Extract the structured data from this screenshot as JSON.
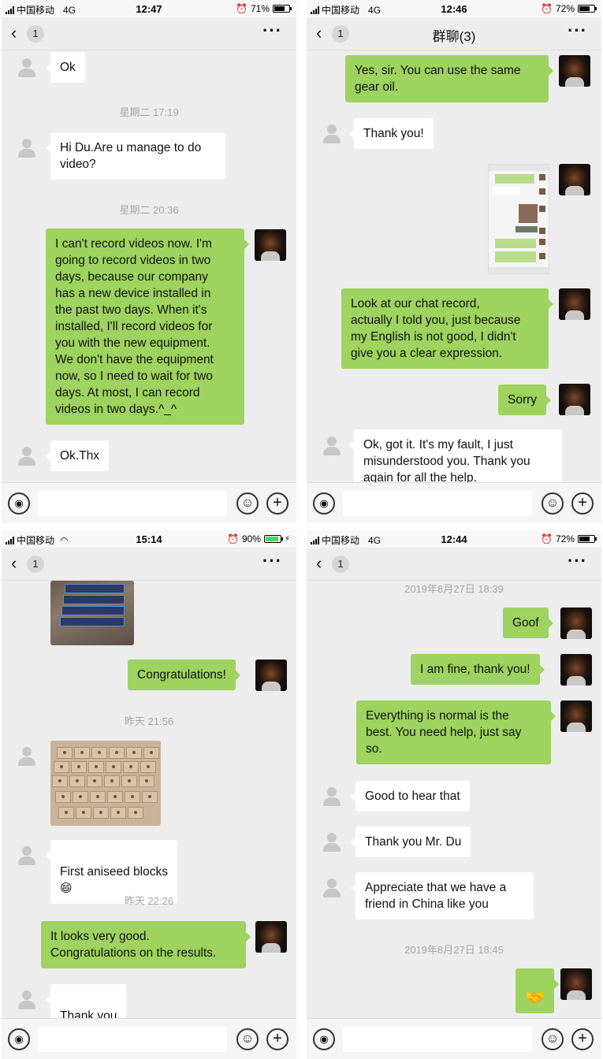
{
  "panels": [
    {
      "status": {
        "carrier": "中国移动",
        "network": "4G",
        "time": "12:47",
        "battery": "71%"
      },
      "nav": {
        "back": "‹",
        "badge": "1",
        "title": "",
        "more": "···"
      },
      "timestamps": [
        "星期二 17:19",
        "星期二 20:36"
      ],
      "messages": [
        {
          "text": "Ok"
        },
        {
          "text": "Hi Du.Are u manage to do\nvideo?"
        },
        {
          "text": "I can't record videos now. I'm\ngoing to record videos in two\ndays, because our company\nhas a new device installed in\nthe past two days. When it's\ninstalled, I'll record videos for\nyou with the new equipment.\nWe don't have the equipment\nnow, so I need to wait for two\ndays. At most, I can record\nvideos in two days.^_^"
        },
        {
          "text": "Ok.Thx"
        }
      ]
    },
    {
      "status": {
        "carrier": "中国移动",
        "network": "4G",
        "time": "12:46",
        "battery": "72%"
      },
      "nav": {
        "back": "‹",
        "badge": "1",
        "title": "群聊(3)",
        "more": "···"
      },
      "messages": [
        {
          "text": "Yes, sir. You can use the same\ngear oil."
        },
        {
          "text": "Thank you!"
        },
        {
          "text": "Look at our chat record,\nactually I told you, just because\nmy English is not good, I didn't\ngive you a clear expression."
        },
        {
          "text": "Sorry"
        },
        {
          "text": "Ok, got it. It's my fault, I just\nmisunderstood you.  Thank you\nagain for all the help."
        }
      ]
    },
    {
      "status": {
        "carrier": "中国移动",
        "network": "wifi",
        "time": "15:14",
        "battery": "90%"
      },
      "nav": {
        "back": "‹",
        "badge": "1",
        "title": "",
        "more": "···"
      },
      "timestamps": [
        "昨天 21:56",
        "昨天 22:26"
      ],
      "messages": [
        {
          "text": "Congratulations!"
        },
        {
          "text": "First aniseed blocks",
          "emoji": "😄"
        },
        {
          "text": "It looks very good.\nCongratulations on the results."
        },
        {
          "text": "Thank you",
          "emoji": "😊"
        }
      ]
    },
    {
      "status": {
        "carrier": "中国移动",
        "network": "4G",
        "time": "12:44",
        "battery": "72%"
      },
      "nav": {
        "back": "‹",
        "badge": "1",
        "title": "",
        "more": "···"
      },
      "timestamps": [
        "2019年8月27日 18:39",
        "2019年8月27日 18:45"
      ],
      "messages": [
        {
          "text": "Goof"
        },
        {
          "text": "I am fine, thank you!"
        },
        {
          "text": "Everything is normal is the\nbest. You need help, just say\nso."
        },
        {
          "text": "Good to hear that"
        },
        {
          "text": "Thank you Mr. Du"
        },
        {
          "text": "Appreciate that we have a\nfriend in China like you"
        },
        {
          "emoji": "🤝"
        }
      ]
    }
  ],
  "icons": {
    "voice": "voice-icon",
    "emoji": "emoji-icon",
    "plus": "plus-icon",
    "avatar_contact": "default-avatar-icon",
    "avatar_me": "user-photo-avatar"
  },
  "colors": {
    "outgoing_bubble": "#9dd35e",
    "incoming_bubble": "#ffffff",
    "background": "#ededed",
    "timestamp": "#a6a6a6"
  }
}
